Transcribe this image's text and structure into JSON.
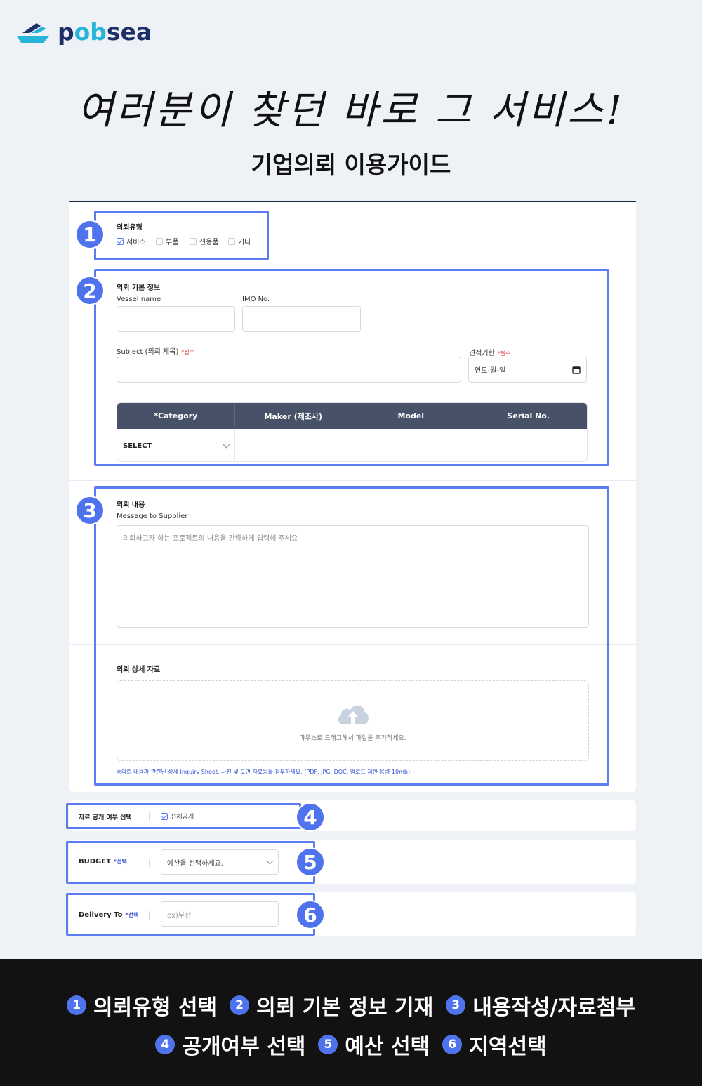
{
  "brand": {
    "name_pre": "p",
    "name_oo": "ob",
    "name_post": "sea",
    "primary_color": "#1d2f66",
    "accent_color": "#25b5d8"
  },
  "headline": "여러분이 찾던 바로 그 서비스!",
  "subtitle": "기업의뢰 이용가이드",
  "highlight_color": "#4f73ec",
  "steps_badges": [
    "1",
    "2",
    "3",
    "4",
    "5",
    "6"
  ],
  "section1": {
    "title": "의뢰유형",
    "options": [
      {
        "label": "서비스",
        "checked": true
      },
      {
        "label": "부품",
        "checked": false
      },
      {
        "label": "선용품",
        "checked": false
      },
      {
        "label": "기타",
        "checked": false
      }
    ]
  },
  "section2": {
    "title": "의뢰 기본 정보",
    "vessel_label": "Vessel name",
    "imo_label": "IMO No.",
    "subject_label": "Subject (의뢰 제목)",
    "subject_required": "*필수",
    "deadline_label": "견적기한",
    "deadline_required": "*필수",
    "deadline_placeholder": "연도-월-일",
    "table_headers": [
      "*Category",
      "Maker (제조사)",
      "Model",
      "Serial No."
    ],
    "category_select": "SELECT"
  },
  "section3": {
    "title": "의뢰 내용",
    "message_label": "Message to Supplier",
    "message_placeholder": "의뢰하고자 하는 프로젝트의 내용을 간략하게 입력해 주세요",
    "files_title": "의뢰 상세 자료",
    "dropzone_text": "마우스로 드래그해서 파일을 추가하세요.",
    "note": "※의뢰 내용과 관련된 상세 Inquiry Sheet, 사진 및 도면 자료등을 첨부하세요. (PDF, JPG, DOC, 업로드 제한 용량 10mb)"
  },
  "section4": {
    "label": "자료 공개 여부 선택",
    "option": "전체공개",
    "checked": true
  },
  "section5": {
    "label": "BUDGET",
    "tag": "*선택",
    "placeholder": "예산을 선택하세요."
  },
  "section6": {
    "label": "Delivery To",
    "tag": "*선택",
    "placeholder": "ex)부산"
  },
  "legend": [
    {
      "num": "1",
      "text": "의뢰유형 선택"
    },
    {
      "num": "2",
      "text": "의뢰 기본 정보 기재"
    },
    {
      "num": "3",
      "text": "내용작성/자료첨부"
    },
    {
      "num": "4",
      "text": "공개여부 선택"
    },
    {
      "num": "5",
      "text": "예산 선택"
    },
    {
      "num": "6",
      "text": "지역선택"
    }
  ]
}
